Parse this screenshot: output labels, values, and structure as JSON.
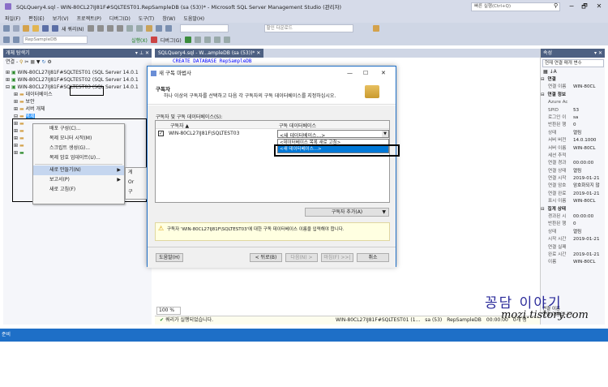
{
  "title": {
    "text": "SQLQuery4.sql - WIN-80CL27IJ81F#SQLTEST01.RepSampleDB (sa (53))* - Microsoft SQL Server Management Studio (관리자)",
    "quick_launch": "빠른 실행(Ctrl+Q)",
    "buttons": [
      "−",
      "🗗",
      "✕"
    ]
  },
  "menu": [
    "파일(F)",
    "편집(E)",
    "보기(V)",
    "프로젝트(P)",
    "디버그(D)",
    "도구(T)",
    "창(W)",
    "도움말(H)"
  ],
  "toolbar": {
    "new_query": "새 쿼리(N)",
    "database_combo": "RepSampleDB",
    "execute": "실행(X)",
    "debug": "디버그(G)",
    "find_label": "할인 다운로드"
  },
  "object_explorer": {
    "title": "개체 탐색기",
    "connect_label": "연결 -",
    "servers": [
      "WIN-80CL27IJ81F#SQLTEST01 (SQL Server 14.0.1",
      "WIN-80CL27IJ81F#SQLTEST02 (SQL Server 14.0.1",
      "WIN-80CL27IJ81F#SQLTEST03 (SQL Server 14.0.1"
    ],
    "server3_highlight": "#SQLTEST03",
    "children": [
      "데이터베이스",
      "보안",
      "서버 개체",
      "복제"
    ]
  },
  "context_menu": {
    "items": [
      "배포 구성(C)...",
      "복제 모니터 시작(M)",
      "스크립트 생성(G)...",
      "복제 암호 업데이트(U)...",
      "새로 만들기(N)",
      "보고서(P)",
      "새로 고침(F)"
    ],
    "submenu_letters": [
      "게",
      "Or",
      "구"
    ]
  },
  "editor": {
    "tab": "SQLQuery4.sql - W...ampleDB (sa (53))*",
    "code_line": "CREATE DATABASE RepSampleDB",
    "zoom": "100 %"
  },
  "status": {
    "message": "쿼리가 실행되었습니다.",
    "server": "WIN-80CL27IJ81F#SQLTEST01 (1...",
    "user": "sa (53)",
    "db": "RepSampleDB",
    "time": "00:00:00",
    "rows": "0개 행",
    "ready": "준비"
  },
  "dialog": {
    "title": "새 구독 마법사",
    "heading": "구독자",
    "description": "하나 이상의 구독자를 선택하고 다음 각 구독자의 구독 데이터베이스를 지정하십시오.",
    "list_label": "구독자 및 구독 데이터베이스(S):",
    "col_subscriber": "구독자",
    "col_database": "구독 데이터베이스",
    "row_subscriber": "WIN-80CL27IJ81F\\SQLTEST03",
    "row_database": "<새 데이터베이스...>",
    "dropdown_options": [
      "<데이터베이스 목록 새로 고침>",
      "<새 데이터베이스...>"
    ],
    "add_subscriber": "구독자 추가(A)",
    "warning": "구독자 'WIN-80CL27IJ81F\\SQLTEST03'에 대한 구독 데이터베이스 이름을 입력해야 합니다.",
    "buttons": {
      "help": "도움말(H)",
      "back": "< 뒤로(B)",
      "next": "다음(N) >",
      "finish": "마침(F) >>|",
      "cancel": "취소"
    }
  },
  "properties": {
    "title": "속성",
    "combo": "현재 연결 매개 변수",
    "rows": [
      {
        "type": "cat",
        "k": "연결",
        "v": ""
      },
      {
        "type": "row",
        "k": "연결 이름",
        "v": "WIN-80CL"
      },
      {
        "type": "cat",
        "k": "연결 정보",
        "v": ""
      },
      {
        "type": "row",
        "k": "Azure Ac",
        "v": ""
      },
      {
        "type": "row",
        "k": "SPID",
        "v": "53"
      },
      {
        "type": "row",
        "k": "로그인 이",
        "v": "sa"
      },
      {
        "type": "row",
        "k": "반환된 행",
        "v": "0"
      },
      {
        "type": "row",
        "k": "상태",
        "v": "열림"
      },
      {
        "type": "row",
        "k": "서버 버전",
        "v": "14.0.1000"
      },
      {
        "type": "row",
        "k": "서버 이름",
        "v": "WIN-80CL"
      },
      {
        "type": "row",
        "k": "세션 추적",
        "v": ""
      },
      {
        "type": "row",
        "k": "연결 경과",
        "v": "00:00:00"
      },
      {
        "type": "row",
        "k": "연결 상태",
        "v": "열림"
      },
      {
        "type": "row",
        "k": "연결 시작",
        "v": "2019-01-21"
      },
      {
        "type": "row",
        "k": "연결 암호",
        "v": "암호화되지 않"
      },
      {
        "type": "row",
        "k": "연결 완료",
        "v": "2019-01-21"
      },
      {
        "type": "row",
        "k": "표시 이름",
        "v": "WIN-80CL"
      },
      {
        "type": "cat",
        "k": "집계 상태",
        "v": ""
      },
      {
        "type": "row",
        "k": "경과된 시",
        "v": "00:00:00"
      },
      {
        "type": "row",
        "k": "반환된 행",
        "v": "0"
      },
      {
        "type": "row",
        "k": "상태",
        "v": "열림"
      },
      {
        "type": "row",
        "k": "시작 시간",
        "v": "2019-01-21"
      },
      {
        "type": "row",
        "k": "연결 실패",
        "v": ""
      },
      {
        "type": "row",
        "k": "완료 시간",
        "v": "2019-01-21"
      },
      {
        "type": "row",
        "k": "이름",
        "v": "WIN-80CL"
      }
    ],
    "footer": "연결 이름\n연결 이름입니다."
  },
  "watermark": {
    "line1": "꽁담 이야기",
    "line2": "mozi.tistory.com"
  }
}
